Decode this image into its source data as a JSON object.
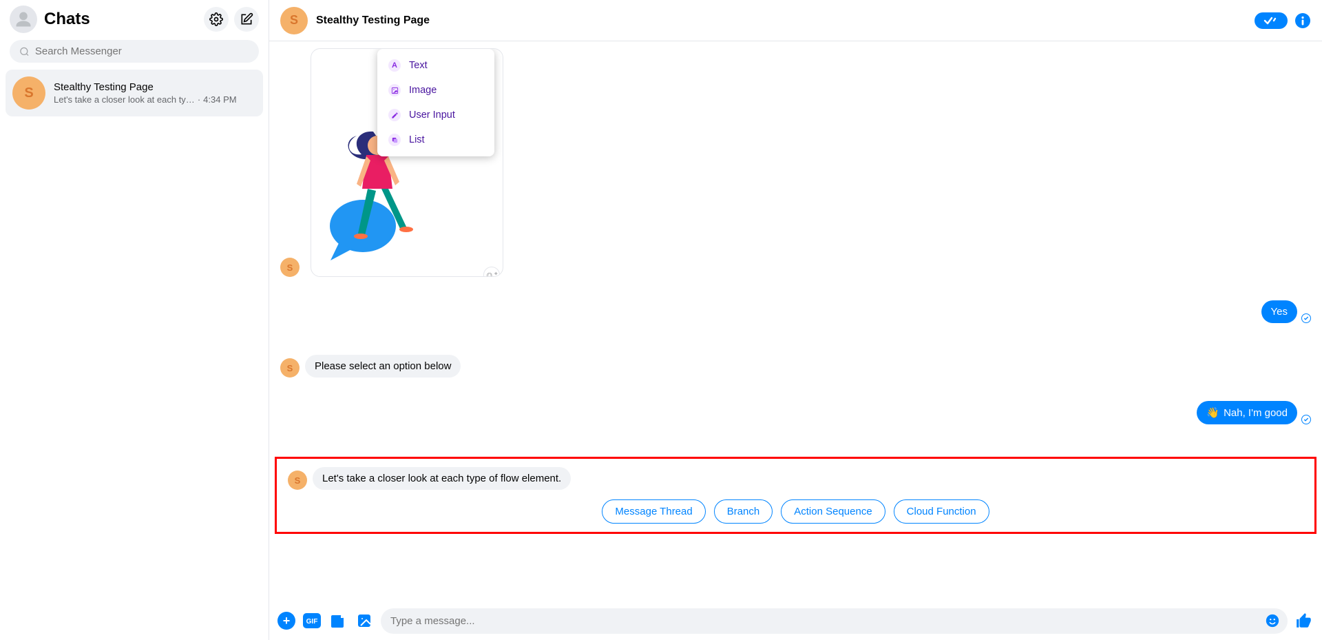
{
  "sidebar": {
    "title": "Chats",
    "search_placeholder": "Search Messenger",
    "conversations": [
      {
        "avatar_letter": "S",
        "title": "Stealthy Testing Page",
        "preview": "Let's take a closer look at each ty…",
        "time": "4:34 PM"
      }
    ]
  },
  "chat": {
    "header": {
      "avatar_letter": "S",
      "title": "Stealthy Testing Page"
    },
    "card": {
      "dropdown_items": [
        {
          "icon": "A",
          "label": "Text"
        },
        {
          "icon": "image-icon",
          "label": "Image"
        },
        {
          "icon": "pencil-icon",
          "label": "User Input"
        },
        {
          "icon": "list-icon",
          "label": "List"
        }
      ]
    },
    "messages": {
      "me_yes": "Yes",
      "bot_select": "Please select an option below",
      "me_nah": "Nah, I'm good",
      "bot_flow": "Let's take a closer look at each type of flow element."
    },
    "quick_replies": [
      "Message Thread",
      "Branch",
      "Action Sequence",
      "Cloud Function"
    ],
    "composer_placeholder": "Type a message...",
    "avatar_letter_small": "S"
  }
}
